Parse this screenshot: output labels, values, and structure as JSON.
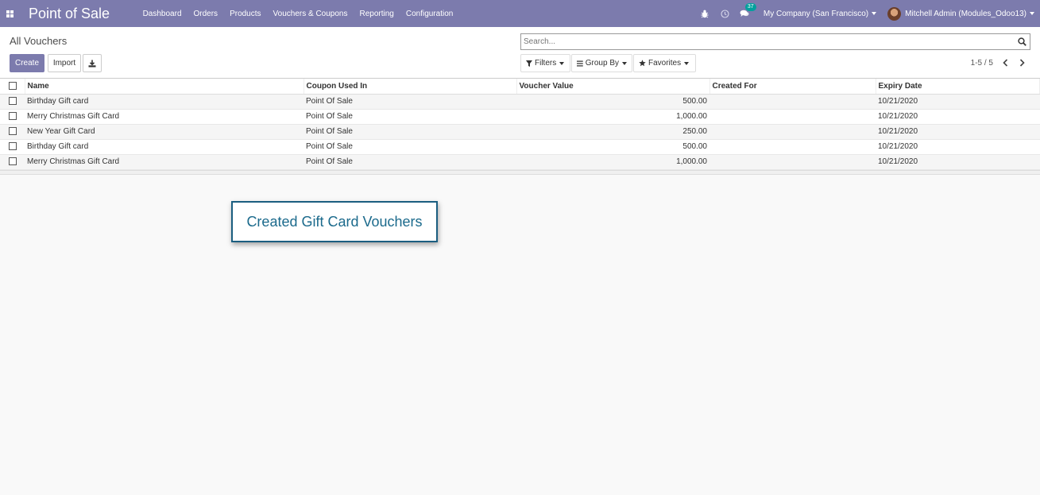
{
  "navbar": {
    "brand": "Point of Sale",
    "menu": [
      "Dashboard",
      "Orders",
      "Products",
      "Vouchers & Coupons",
      "Reporting",
      "Configuration"
    ],
    "message_count": "37",
    "company": "My Company (San Francisco)",
    "user": "Mitchell Admin (Modules_Odoo13)",
    "color": "#7c7bad"
  },
  "control_panel": {
    "breadcrumb": "All Vouchers",
    "create_label": "Create",
    "import_label": "Import",
    "search_placeholder": "Search...",
    "filters_label": "Filters",
    "groupby_label": "Group By",
    "favorites_label": "Favorites",
    "pager": "1-5 / 5"
  },
  "table": {
    "columns": [
      "Name",
      "Coupon Used In",
      "Voucher Value",
      "Created For",
      "Expiry Date"
    ],
    "rows": [
      {
        "name": "Birthday Gift card",
        "used_in": "Point Of Sale",
        "value": "500.00",
        "created_for": "",
        "expiry": "10/21/2020"
      },
      {
        "name": "Merry Christmas Gift Card",
        "used_in": "Point Of Sale",
        "value": "1,000.00",
        "created_for": "",
        "expiry": "10/21/2020"
      },
      {
        "name": "New Year Gift Card",
        "used_in": "Point Of Sale",
        "value": "250.00",
        "created_for": "",
        "expiry": "10/21/2020"
      },
      {
        "name": "Birthday Gift card",
        "used_in": "Point Of Sale",
        "value": "500.00",
        "created_for": "",
        "expiry": "10/21/2020"
      },
      {
        "name": "Merry Christmas Gift Card",
        "used_in": "Point Of Sale",
        "value": "1,000.00",
        "created_for": "",
        "expiry": "10/21/2020"
      }
    ]
  },
  "callout": {
    "text": "Created Gift Card Vouchers",
    "color": "#1b6a8c"
  }
}
